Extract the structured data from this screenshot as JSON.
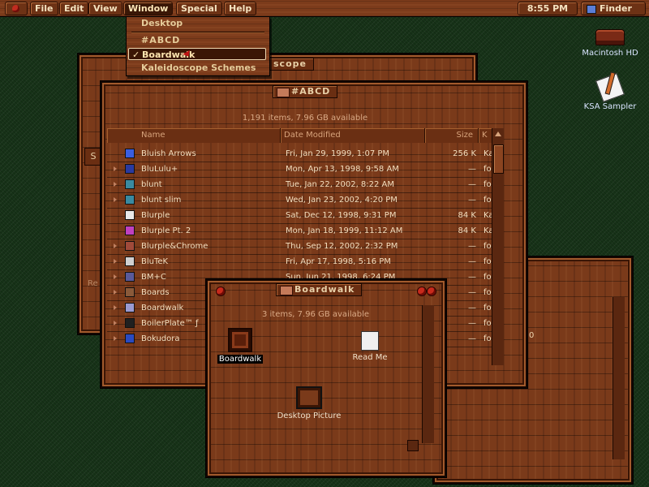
{
  "menubar": {
    "items": [
      "File",
      "Edit",
      "View",
      "Window",
      "Special",
      "Help"
    ],
    "clock": "8:55 PM",
    "app": "Finder"
  },
  "window_menu": {
    "items": [
      "Desktop",
      "#ABCD",
      "Boardwalk",
      "Kaleidoscope Schemes"
    ],
    "checked": "Boardwalk"
  },
  "desktop_icons": {
    "hd": "Macintosh HD",
    "sampler": "KSA Sampler"
  },
  "back_window": {
    "title_fragment": "scope"
  },
  "abcd_window": {
    "title": "#ABCD",
    "status": "1,191 items, 7.96 GB available",
    "columns": [
      "Name",
      "Date Modified",
      "Size",
      "K"
    ],
    "rows": [
      {
        "name": "Bluish Arrows",
        "date": "Fri, Jan 29, 1999, 1:07 PM",
        "size": "256 K",
        "kind": "Ka",
        "color": "#3a5ee0",
        "folder": false
      },
      {
        "name": "BluLulu+",
        "date": "Mon, Apr 13, 1998, 9:58 AM",
        "size": "—",
        "kind": "fol",
        "color": "#2a3aa0",
        "folder": true
      },
      {
        "name": "blunt",
        "date": "Tue, Jan 22, 2002, 8:22 AM",
        "size": "—",
        "kind": "fol",
        "color": "#3a8aa0",
        "folder": true
      },
      {
        "name": "blunt slim",
        "date": "Wed, Jan 23, 2002, 4:20 PM",
        "size": "—",
        "kind": "fol",
        "color": "#3a8aa0",
        "folder": true
      },
      {
        "name": "Blurple",
        "date": "Sat, Dec 12, 1998, 9:31 PM",
        "size": "84 K",
        "kind": "Ka",
        "color": "#e8e8e8",
        "folder": false
      },
      {
        "name": "Blurple Pt. 2",
        "date": "Mon, Jan 18, 1999, 11:12 AM",
        "size": "84 K",
        "kind": "Ka",
        "color": "#c040c0",
        "folder": false
      },
      {
        "name": "Blurple&Chrome",
        "date": "Thu, Sep 12, 2002, 2:32 PM",
        "size": "—",
        "kind": "fol",
        "color": "#a04a3a",
        "folder": true
      },
      {
        "name": "BluTeK",
        "date": "Fri, Apr 17, 1998, 5:16 PM",
        "size": "—",
        "kind": "fol",
        "color": "#d0d0d0",
        "folder": true
      },
      {
        "name": "BM+C",
        "date": "Sun, Jun 21, 1998, 6:24 PM",
        "size": "—",
        "kind": "fol",
        "color": "#5a5a9a",
        "folder": true
      },
      {
        "name": "Boards",
        "date": "",
        "size": "—",
        "kind": "fol",
        "color": "#8a5a3a",
        "folder": true
      },
      {
        "name": "Boardwalk",
        "date": "",
        "size": "—",
        "kind": "fol",
        "color": "#9a9ad0",
        "folder": true
      },
      {
        "name": "BoilerPlate™ ƒ",
        "date": "",
        "size": "—",
        "kind": "fol",
        "color": "#202020",
        "folder": true
      },
      {
        "name": "Bokudora",
        "date": "",
        "size": "—",
        "kind": "fol",
        "color": "#2a4ac0",
        "folder": true
      }
    ]
  },
  "boardwalk_window": {
    "title": "Boardwalk",
    "status": "3 items, 7.96 GB available",
    "icons": [
      "Boardwalk",
      "Read Me",
      "Desktop Picture"
    ]
  },
  "back_left_window": {
    "fragment_s": "S",
    "fragment_re": "Re"
  },
  "right_window": {
    "fragment": "0"
  }
}
